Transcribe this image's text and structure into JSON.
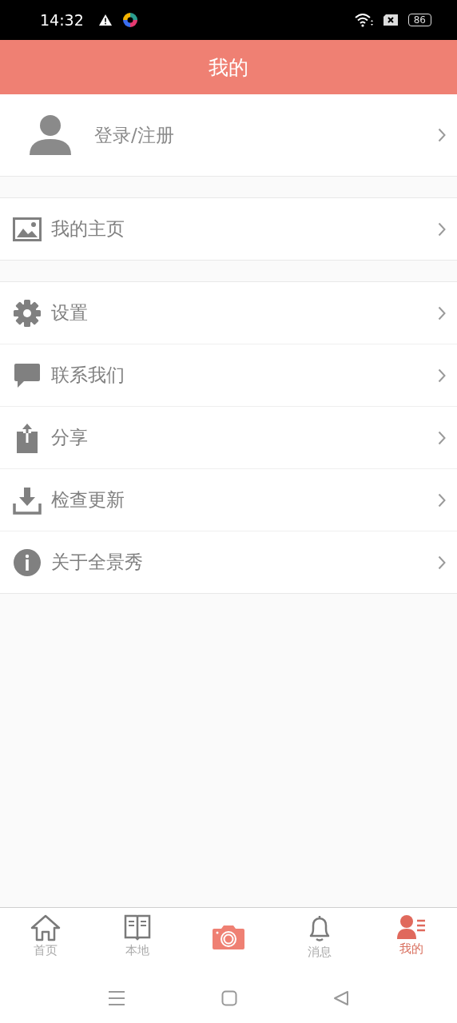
{
  "status_bar": {
    "time": "14:32",
    "battery": "86"
  },
  "header": {
    "title": "我的"
  },
  "login": {
    "label": "登录/注册"
  },
  "groups": [
    [
      {
        "label": "我的主页"
      }
    ],
    [
      {
        "label": "设置"
      },
      {
        "label": "联系我们"
      },
      {
        "label": "分享"
      },
      {
        "label": "检查更新"
      },
      {
        "label": "关于全景秀"
      }
    ]
  ],
  "tab_bar": [
    {
      "label": "首页",
      "selected": false
    },
    {
      "label": "本地",
      "selected": false
    },
    {
      "kind": "camera",
      "selected": false
    },
    {
      "label": "消息",
      "selected": false
    },
    {
      "label": "我的",
      "selected": true
    }
  ]
}
